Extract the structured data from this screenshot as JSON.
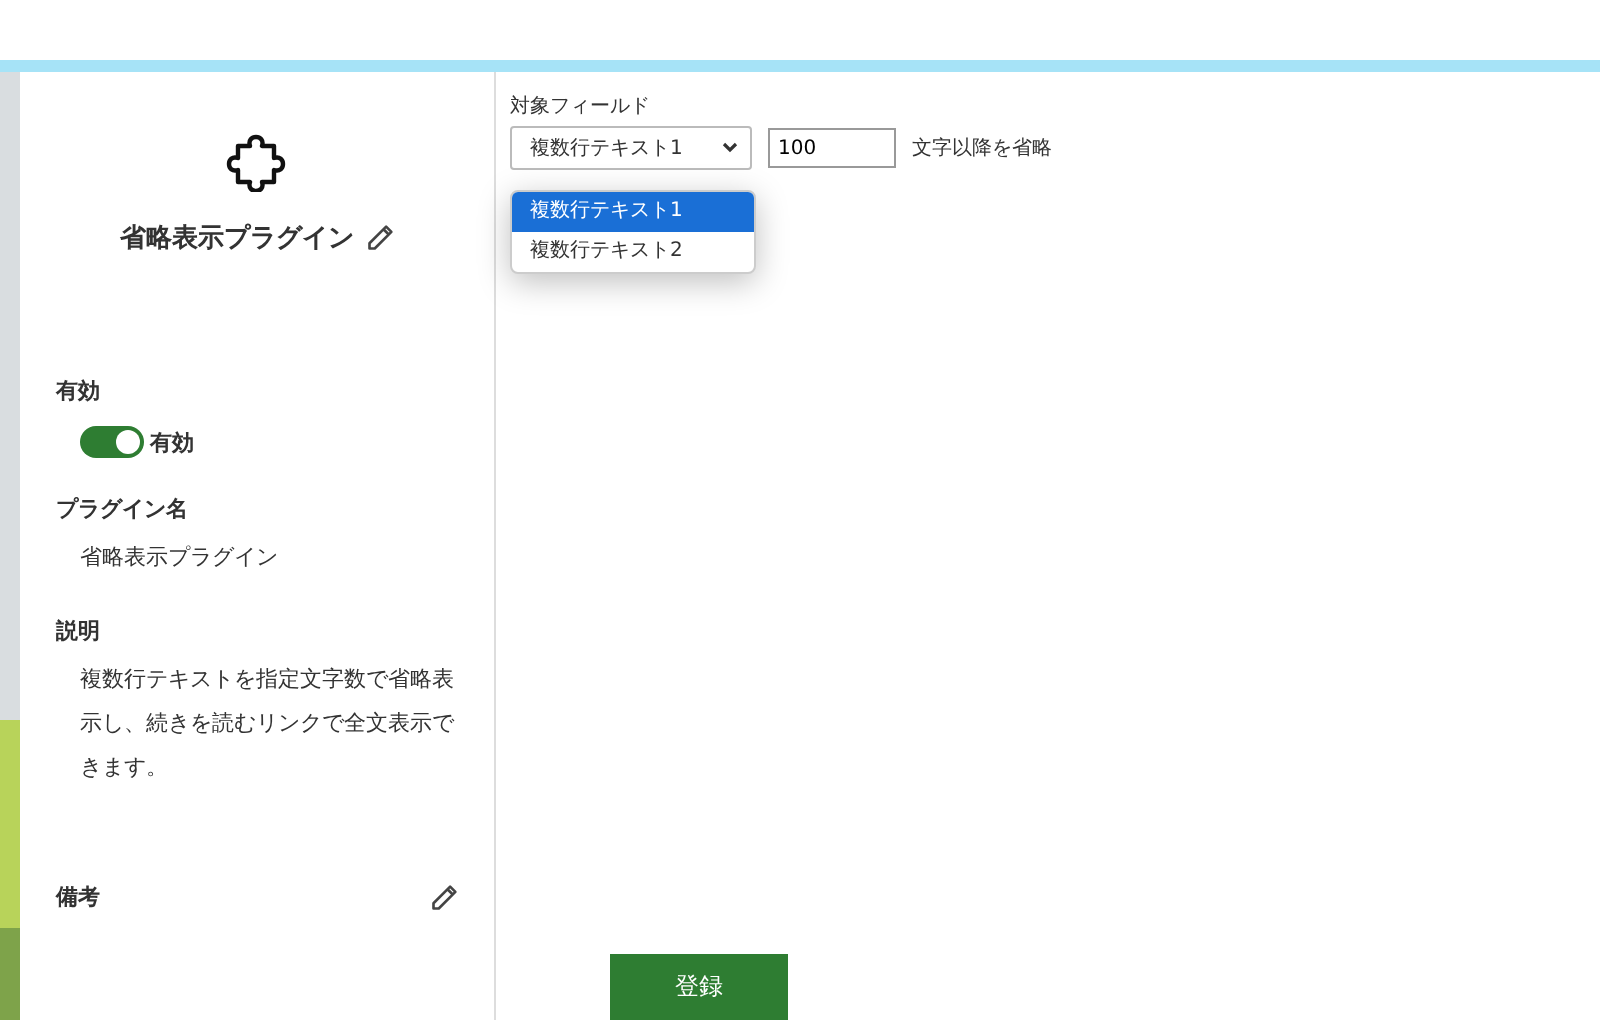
{
  "plugin": {
    "title": "省略表示プラグイン"
  },
  "sections": [
    {
      "kind": "toggle",
      "label": "有効",
      "toggle_label": "有効",
      "on": true
    },
    {
      "kind": "text",
      "label": "プラグイン名",
      "text": "省略表示プラグイン"
    },
    {
      "kind": "text",
      "label": "説明",
      "text": "複数行テキストを指定文字数で省略表示し、続きを読むリンクで全文表示できます。"
    },
    {
      "kind": "editable",
      "label": "備考"
    }
  ],
  "settings": {
    "field_label": "対象フィールド",
    "select_value": "複数行テキスト1",
    "options": [
      {
        "label": "複数行テキスト1",
        "selected": true
      },
      {
        "label": "複数行テキスト2",
        "selected": false
      }
    ],
    "count": "100",
    "suffix": "文字以降を省略"
  },
  "buttons": [
    "登録"
  ]
}
